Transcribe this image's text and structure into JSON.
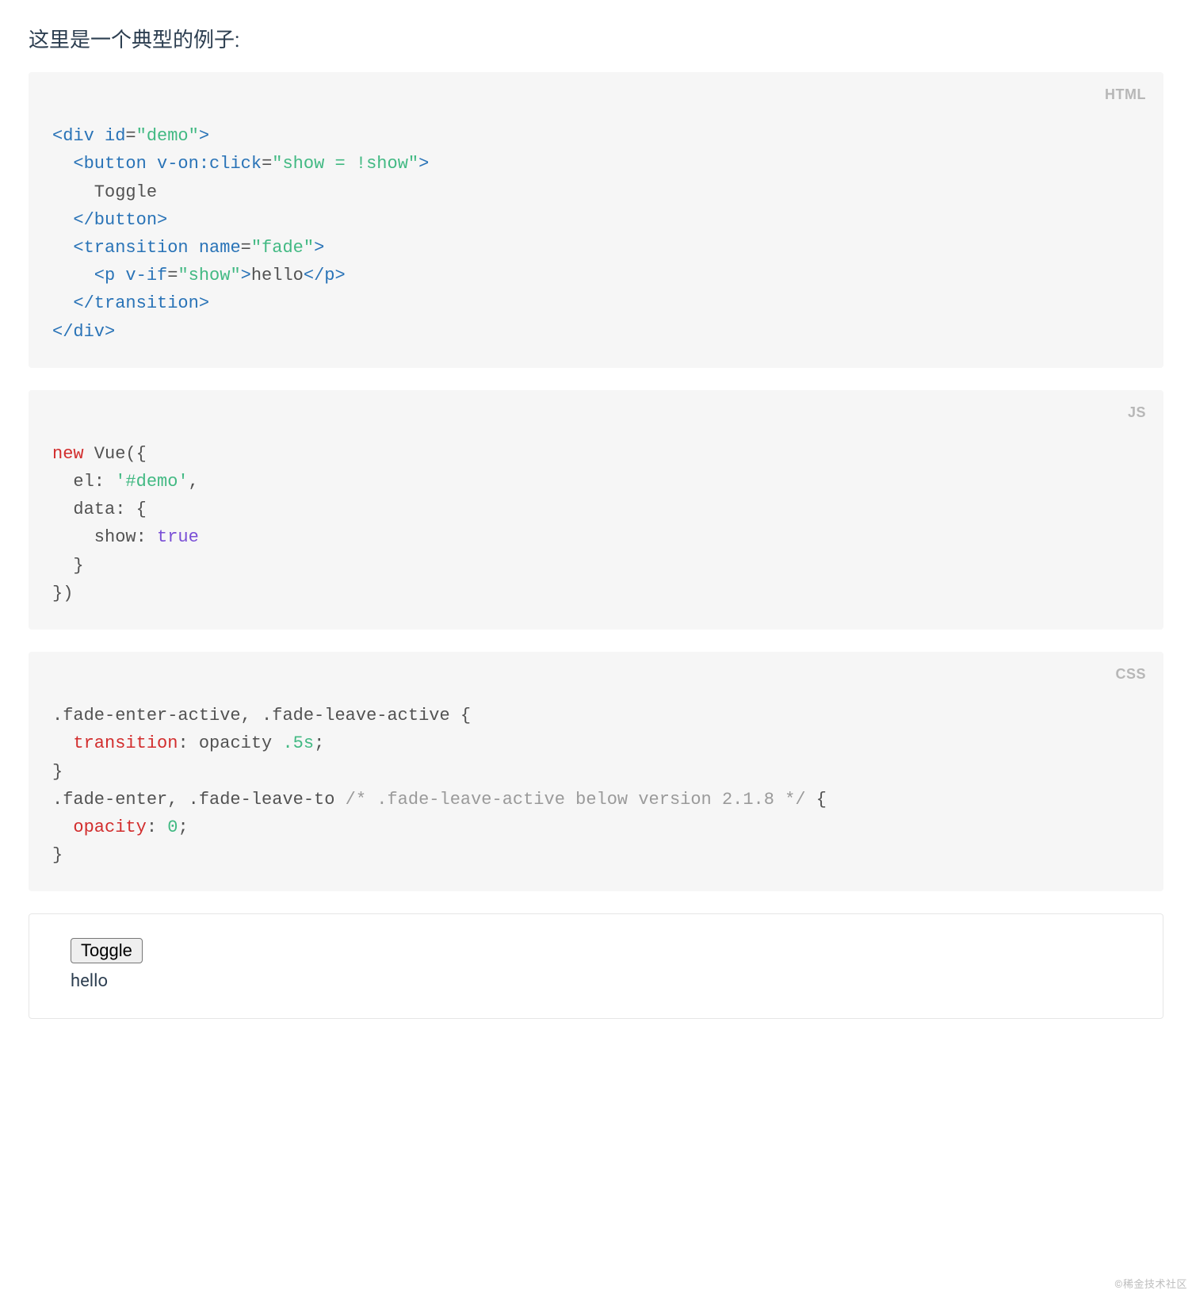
{
  "intro": "这里是一个典型的例子:",
  "labels": {
    "html": "HTML",
    "js": "JS",
    "css": "CSS"
  },
  "html_code": {
    "l1": {
      "a": "<div",
      "b": " id",
      "c": "=",
      "d": "\"demo\"",
      "e": ">"
    },
    "l2": {
      "a": "  <button",
      "b": " v-on:click",
      "c": "=",
      "d": "\"show = !show\"",
      "e": ">"
    },
    "l3": "    Toggle",
    "l4": "  </button>",
    "l5": {
      "a": "  <transition",
      "b": " name",
      "c": "=",
      "d": "\"fade\"",
      "e": ">"
    },
    "l6": {
      "a": "    <p",
      "b": " v-if",
      "c": "=",
      "d": "\"show\"",
      "e": ">",
      "f": "hello",
      "g": "</p>"
    },
    "l7": "  </transition>",
    "l8": "</div>"
  },
  "js_code": {
    "l1": {
      "a": "new",
      "b": " Vue({"
    },
    "l2": {
      "a": "  el: ",
      "b": "'#demo'",
      "c": ","
    },
    "l3": "  data: {",
    "l4": {
      "a": "    show: ",
      "b": "true"
    },
    "l5": "  }",
    "l6": "})"
  },
  "css_code": {
    "l1": ".fade-enter-active, .fade-leave-active {",
    "l2": {
      "a": "  ",
      "b": "transition",
      "c": ": opacity ",
      "d": ".5s",
      "e": ";"
    },
    "l3": "}",
    "l4": {
      "a": ".fade-enter, .fade-leave-to ",
      "b": "/* .fade-leave-active below version 2.1.8 */",
      "c": " {"
    },
    "l5": {
      "a": "  ",
      "b": "opacity",
      "c": ": ",
      "d": "0",
      "e": ";"
    },
    "l6": "}"
  },
  "demo": {
    "button": "Toggle",
    "text": "hello"
  },
  "watermark": "©稀金技术社区"
}
